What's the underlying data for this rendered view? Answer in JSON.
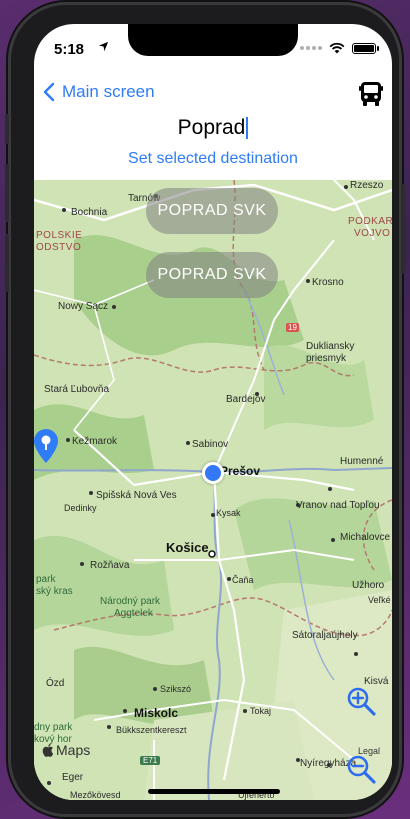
{
  "status_bar": {
    "time": "5:18"
  },
  "nav": {
    "back_label": "Main screen"
  },
  "search": {
    "value": "Poprad"
  },
  "actions": {
    "set_destination": "Set selected destination"
  },
  "results": [
    {
      "label": "POPRAD  SVK"
    },
    {
      "label": "POPRAD  SVK"
    }
  ],
  "map": {
    "attribution": "Maps",
    "legal": "Legal",
    "labels": {
      "rzeszow": "Rzeszo",
      "tarnow": "Tarnów",
      "bochnia": "Bochnia",
      "polskie": "POLSKIE",
      "odstvo": "ODSTVO",
      "podkar": "PODKAR",
      "vojvo": "VOJVO",
      "krosno": "Krosno",
      "nowy_sacz": "Nowy Sącz",
      "road19": "19",
      "duklianský": "Dukliansky",
      "priesmyk": "priesmyk",
      "stara_lubovna": "Stará Ľubovňa",
      "bardejov": "Bardejov",
      "kezmarok": "Kežmarok",
      "sabinov": "Sabinov",
      "presov": "Prešov",
      "humenne": "Humenné",
      "spisska": "Spišská Nová Ves",
      "vranov": "Vranov nad Topľou",
      "dedinky": "Dedinky",
      "kysak": "Kysak",
      "michalovce": "Michalovce",
      "kosice": "Košice",
      "roznava": "Rožňava",
      "park": "park",
      "sky_kras": "ský kras",
      "cana": "Čaňa",
      "uzhorod": "Užhoro",
      "velke": "Veľké",
      "narodny_park": "Národný park",
      "aggtelek": "Aggtelek",
      "satoraljaujhely": "Sátoraljaújhely",
      "ozd": "Ózd",
      "kisv": "Kisvá",
      "szikszo": "Szikszó",
      "tokaj": "Tokaj",
      "dny_park": "dny park",
      "kovy_hor": "kový hor",
      "miskolc": "Miskolc",
      "bukkszentkereszt": "Bükkszentkereszt",
      "e71": "E71",
      "nyiregyhaza": "Nyíregyháza",
      "eger": "Eger",
      "mezokovesd": "Mezőkövesd",
      "ujfeherto": "Újfehértó"
    }
  },
  "colors": {
    "accent": "#2f7cf6",
    "user_location": "#3478f6",
    "map_land": "#cfe3b4",
    "border": "#b5796d"
  }
}
